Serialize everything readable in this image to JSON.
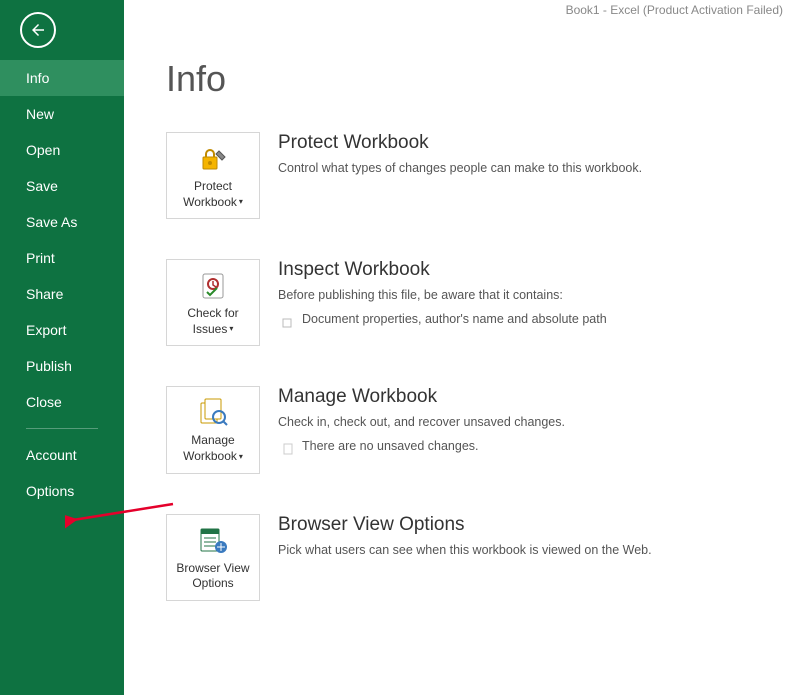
{
  "app_title": "Book1 - Excel (Product Activation Failed)",
  "page_title": "Info",
  "nav": {
    "items": [
      {
        "label": "Info",
        "active": true
      },
      {
        "label": "New"
      },
      {
        "label": "Open"
      },
      {
        "label": "Save"
      },
      {
        "label": "Save As"
      },
      {
        "label": "Print"
      },
      {
        "label": "Share"
      },
      {
        "label": "Export"
      },
      {
        "label": "Publish"
      },
      {
        "label": "Close"
      }
    ],
    "footer": [
      {
        "label": "Account"
      },
      {
        "label": "Options"
      }
    ]
  },
  "sections": {
    "protect": {
      "button_line1": "Protect",
      "button_line2": "Workbook",
      "title": "Protect Workbook",
      "sub": "Control what types of changes people can make to this workbook."
    },
    "inspect": {
      "button_line1": "Check for",
      "button_line2": "Issues",
      "title": "Inspect Workbook",
      "sub": "Before publishing this file, be aware that it contains:",
      "bullet": "Document properties, author's name and absolute path"
    },
    "manage": {
      "button_line1": "Manage",
      "button_line2": "Workbook",
      "title": "Manage Workbook",
      "sub": "Check in, check out, and recover unsaved changes.",
      "bullet": "There are no unsaved changes."
    },
    "browser": {
      "button_line1": "Browser View",
      "button_line2": "Options",
      "title": "Browser View Options",
      "sub": "Pick what users can see when this workbook is viewed on the Web."
    }
  }
}
